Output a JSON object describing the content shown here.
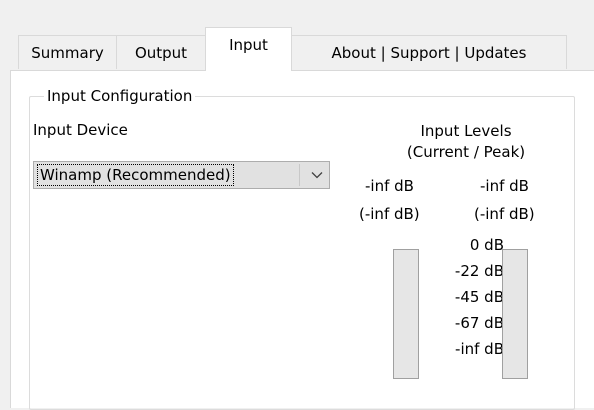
{
  "tabs": [
    {
      "label": "Summary"
    },
    {
      "label": "Output"
    },
    {
      "label": "Input"
    },
    {
      "label": "About | Support | Updates"
    }
  ],
  "group": {
    "title": "Input Configuration"
  },
  "input_device": {
    "label": "Input Device",
    "selected": "Winamp (Recommended)"
  },
  "levels": {
    "title_line1": "Input Levels",
    "title_line2": "(Current / Peak)",
    "left_current": "-inf dB",
    "left_peak": "(-inf dB)",
    "right_current": "-inf dB",
    "right_peak": "(-inf dB)",
    "scale": [
      "0 dB",
      "-22 dB",
      "-45 dB",
      "-67 dB",
      "-inf dB"
    ],
    "left_meter_fill": 0,
    "right_meter_fill": 0
  },
  "colors": {
    "panel_bg": "#ffffff",
    "window_bg": "#f0f0f0",
    "meter_bg": "#e6e6e6"
  },
  "icons": {
    "combo_arrow": "chevron-down-icon"
  }
}
